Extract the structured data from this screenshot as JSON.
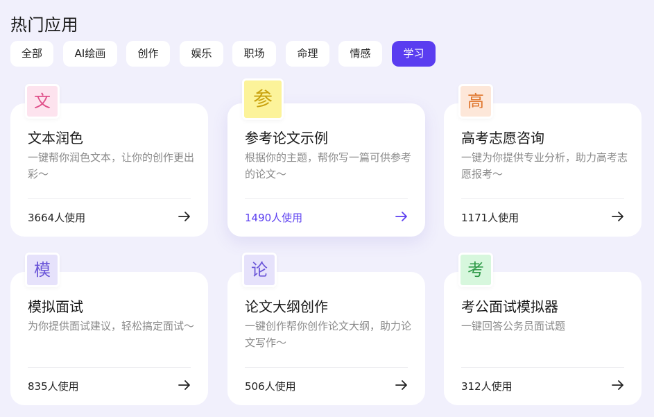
{
  "section": {
    "title": "热门应用"
  },
  "tabs": [
    {
      "label": "全部"
    },
    {
      "label": "AI绘画"
    },
    {
      "label": "创作"
    },
    {
      "label": "娱乐"
    },
    {
      "label": "职场"
    },
    {
      "label": "命理"
    },
    {
      "label": "情感"
    },
    {
      "label": "学习"
    }
  ],
  "active_tab": "学习",
  "cards": [
    {
      "icon_char": "文",
      "icon_bg": "#fde3ee",
      "icon_color": "#e0508a",
      "title": "文本润色",
      "description": "一键帮你润色文本，让你的创作更出彩～",
      "usage": "3664人使用"
    },
    {
      "icon_char": "参",
      "icon_bg": "#fcf39a",
      "icon_color": "#c9a20f",
      "title": "参考论文示例",
      "description": "根据你的主题，帮你写一篇可供参考的论文～",
      "usage": "1490人使用"
    },
    {
      "icon_char": "高",
      "icon_bg": "#fde7d9",
      "icon_color": "#e0772f",
      "title": "高考志愿咨询",
      "description": "一键为你提供专业分析，助力高考志愿报考～",
      "usage": "1171人使用"
    },
    {
      "icon_char": "模",
      "icon_bg": "#e6e2fb",
      "icon_color": "#6a55d8",
      "title": "模拟面试",
      "description": "为你提供面试建议，轻松搞定面试～",
      "usage": "835人使用"
    },
    {
      "icon_char": "论",
      "icon_bg": "#e6e2fb",
      "icon_color": "#6a55d8",
      "title": "论文大纲创作",
      "description": "一键创作帮你创作论文大纲，助力论文写作～",
      "usage": "506人使用"
    },
    {
      "icon_char": "考",
      "icon_bg": "#d7f7dd",
      "icon_color": "#2f9a48",
      "title": "考公面试模拟器",
      "description": "一键回答公务员面试题",
      "usage": "312人使用"
    }
  ],
  "colors": {
    "accent": "#5a3df0",
    "background": "#f1f0fc"
  },
  "icons": {
    "card_arrow": "arrow-right-icon"
  }
}
